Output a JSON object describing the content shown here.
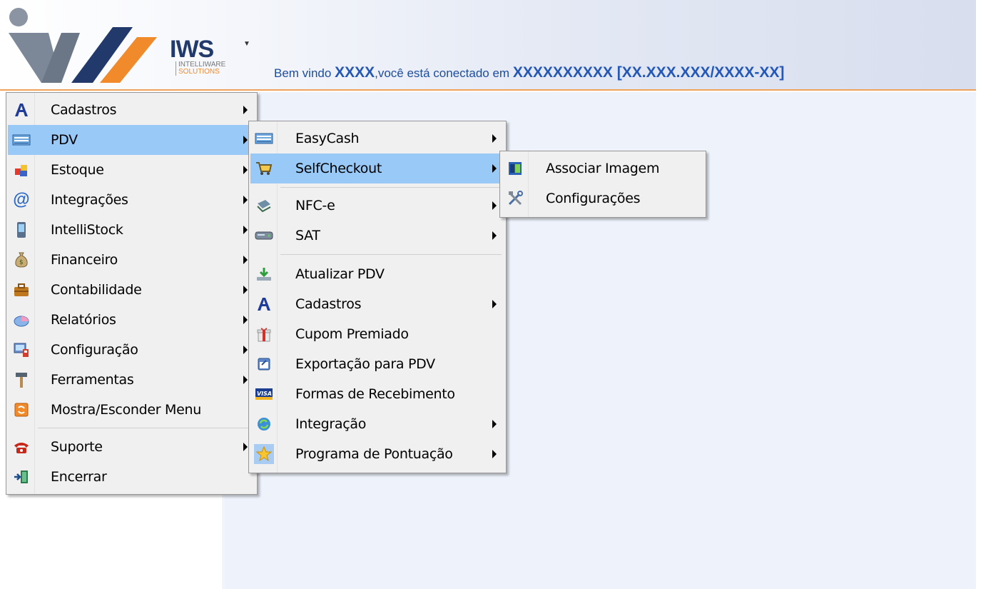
{
  "header": {
    "logo_name": "IWS",
    "logo_sub1": "INTELLIWARE",
    "logo_sub2": "SOLUTIONS",
    "welcome_prefix": "Bem vindo",
    "user": "XXXX",
    "connected_text": ",você está conectado em",
    "company": "XXXXXXXXXX [XX.XXX.XXX/XXXX-XX]"
  },
  "main_menu": {
    "items": [
      {
        "label": "Cadastros",
        "icon": "cadastros-a-icon",
        "submenu": true
      },
      {
        "label": "PDV",
        "icon": "pdv-register-icon",
        "submenu": true,
        "highlighted": true
      },
      {
        "label": "Estoque",
        "icon": "estoque-boxes-icon",
        "submenu": true
      },
      {
        "label": "Integrações",
        "icon": "at-sign-icon",
        "submenu": true
      },
      {
        "label": "IntelliStock",
        "icon": "mobile-device-icon",
        "submenu": true
      },
      {
        "label": "Financeiro",
        "icon": "money-bag-icon",
        "submenu": true
      },
      {
        "label": "Contabilidade",
        "icon": "briefcase-icon",
        "submenu": true
      },
      {
        "label": "Relatórios",
        "icon": "report-chart-icon",
        "submenu": true
      },
      {
        "label": "Configuração",
        "icon": "configuration-icon",
        "submenu": true
      },
      {
        "label": "Ferramentas",
        "icon": "hammer-icon",
        "submenu": true
      },
      {
        "label": "Mostra/Esconder Menu",
        "icon": "toggle-menu-icon",
        "submenu": false
      },
      {
        "label": "Suporte",
        "icon": "phone-icon",
        "submenu": true
      },
      {
        "label": "Encerrar",
        "icon": "exit-door-icon",
        "submenu": false
      }
    ]
  },
  "pdv_menu": {
    "items": [
      {
        "label": "EasyCash",
        "icon": "easycash-register-icon",
        "submenu": true
      },
      {
        "label": "SelfCheckout",
        "icon": "shopping-cart-icon",
        "submenu": true,
        "highlighted": true
      },
      {
        "label": "NFC-e",
        "icon": "nfce-icon",
        "submenu": true
      },
      {
        "label": "SAT",
        "icon": "sat-device-icon",
        "submenu": true
      },
      {
        "label": "Atualizar PDV",
        "icon": "download-update-icon",
        "submenu": false
      },
      {
        "label": "Cadastros",
        "icon": "cadastros-a-icon",
        "submenu": true
      },
      {
        "label": "Cupom Premiado",
        "icon": "gift-icon",
        "submenu": false
      },
      {
        "label": "Exportação para PDV",
        "icon": "export-icon",
        "submenu": false
      },
      {
        "label": "Formas de Recebimento",
        "icon": "visa-card-icon",
        "submenu": false
      },
      {
        "label": "Integração",
        "icon": "sync-icon",
        "submenu": true
      },
      {
        "label": "Programa de Pontuação",
        "icon": "star-icon",
        "submenu": true
      }
    ]
  },
  "selfcheckout_menu": {
    "items": [
      {
        "label": "Associar Imagem",
        "icon": "associate-image-icon"
      },
      {
        "label": "Configurações",
        "icon": "tools-icon"
      }
    ]
  },
  "colors": {
    "menu_highlight": "#99c9f7",
    "header_accent": "#f0a15a",
    "welcome_text": "#2357b8",
    "logo_dark": "#213a6b",
    "logo_orange": "#f08a2b"
  }
}
